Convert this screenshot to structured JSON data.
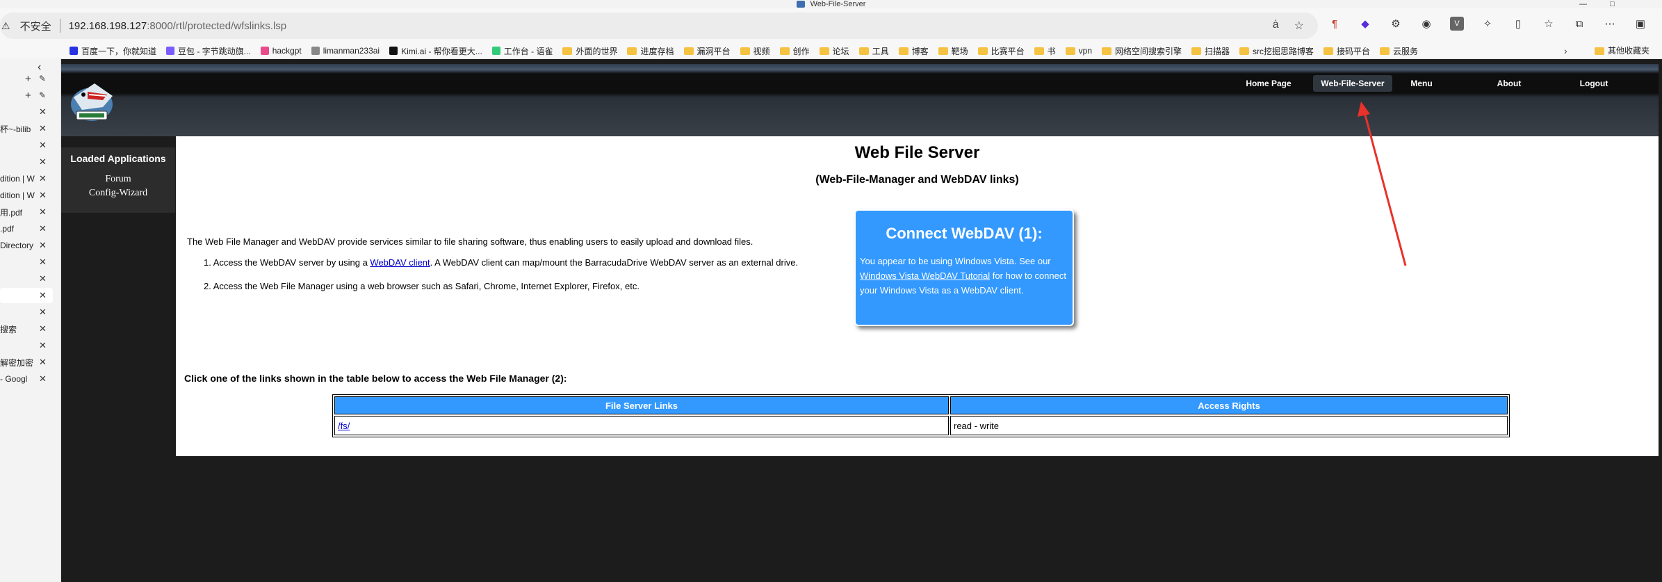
{
  "window": {
    "title": "Web-File-Server"
  },
  "address_bar": {
    "security_label": "不安全",
    "url_host": "192.168.198.127",
    "url_path": ":8000/rtl/protected/wfslinks.lsp"
  },
  "bookmarks": [
    {
      "label": "百度一下，你就知道",
      "kind": "fav",
      "color": "#2932e1"
    },
    {
      "label": "豆包 - 字节跳动旗...",
      "kind": "fav",
      "color": "#7b5cff"
    },
    {
      "label": "hackgpt",
      "kind": "fav",
      "color": "#e94b8a"
    },
    {
      "label": "limanman233ai",
      "kind": "fav",
      "color": "#888888"
    },
    {
      "label": "Kimi.ai - 帮你看更大...",
      "kind": "fav",
      "color": "#111111"
    },
    {
      "label": "工作台 - 语雀",
      "kind": "fav",
      "color": "#31cc79"
    },
    {
      "label": "外面的世界",
      "kind": "folder"
    },
    {
      "label": "进度存档",
      "kind": "folder"
    },
    {
      "label": "漏洞平台",
      "kind": "folder"
    },
    {
      "label": "视频",
      "kind": "folder"
    },
    {
      "label": "创作",
      "kind": "folder"
    },
    {
      "label": "论坛",
      "kind": "folder"
    },
    {
      "label": "工具",
      "kind": "folder"
    },
    {
      "label": "博客",
      "kind": "folder"
    },
    {
      "label": "靶场",
      "kind": "folder"
    },
    {
      "label": "比赛平台",
      "kind": "folder"
    },
    {
      "label": "书",
      "kind": "folder"
    },
    {
      "label": "vpn",
      "kind": "folder"
    },
    {
      "label": "网络空间搜索引擎",
      "kind": "folder"
    },
    {
      "label": "扫描器",
      "kind": "folder"
    },
    {
      "label": "src挖掘思路博客",
      "kind": "folder"
    },
    {
      "label": "接码平台",
      "kind": "folder"
    },
    {
      "label": "云服务",
      "kind": "folder"
    }
  ],
  "bookmarks_other": "其他收藏夹",
  "side_tabs": [
    {
      "label": "",
      "type": "new"
    },
    {
      "label": "",
      "type": "new"
    },
    {
      "label": "",
      "type": "close"
    },
    {
      "label": "杯~-bilib",
      "type": "close"
    },
    {
      "label": "",
      "type": "close"
    },
    {
      "label": "",
      "type": "close"
    },
    {
      "label": "dition | W",
      "type": "close"
    },
    {
      "label": "dition | W",
      "type": "close"
    },
    {
      "label": "用.pdf",
      "type": "close"
    },
    {
      "label": ".pdf",
      "type": "close"
    },
    {
      "label": "Directory",
      "type": "close"
    },
    {
      "label": "",
      "type": "close"
    },
    {
      "label": "",
      "type": "close"
    },
    {
      "label": "",
      "type": "active"
    },
    {
      "label": "",
      "type": "close"
    },
    {
      "label": "搜索",
      "type": "close"
    },
    {
      "label": "",
      "type": "close"
    },
    {
      "label": "解密加密",
      "type": "close"
    },
    {
      "label": "- Googl",
      "type": "close"
    }
  ],
  "site": {
    "nav": [
      {
        "label": "Home Page"
      },
      {
        "label": "Web-File-Server"
      },
      {
        "label": "Menu"
      },
      {
        "label": "About"
      },
      {
        "label": "Logout"
      }
    ],
    "left_nav": {
      "title": "Loaded Applications",
      "links": [
        "Forum",
        "Config-Wizard"
      ]
    }
  },
  "content": {
    "title": "Web File Server",
    "subtitle": "(Web-File-Manager and WebDAV links)",
    "intro": "The Web File Manager and WebDAV provide services similar to file sharing software, thus enabling users to easily upload and download files.",
    "step1_prefix": "Access the WebDAV server by using a ",
    "step1_link": "WebDAV client",
    "step1_suffix": ". A WebDAV client can map/mount the BarracudaDrive WebDAV server as an external drive.",
    "step2": "Access the Web File Manager using a web browser such as Safari, Chrome, Internet Explorer, Firefox, etc.",
    "webdav_box": {
      "title": "Connect WebDAV (1):",
      "text_prefix": "You appear to be using Windows Vista. See our ",
      "link": "Windows Vista WebDAV Tutorial",
      "text_suffix": " for how to connect your Windows Vista as a WebDAV client."
    },
    "table_intro": "Click one of the links shown in the table below to access the Web File Manager (2):",
    "table": {
      "headers": [
        "File Server Links",
        "Access Rights"
      ],
      "rows": [
        {
          "link": "/fs/",
          "rights": "read - write"
        }
      ]
    }
  },
  "colors": {
    "accent_blue": "#3399ff",
    "annotation_arrow": "#e8322a"
  }
}
